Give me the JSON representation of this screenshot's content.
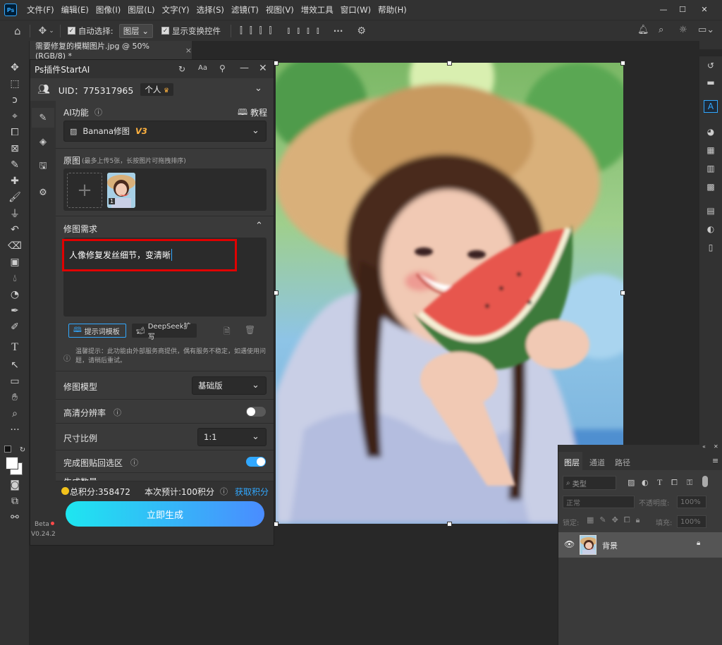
{
  "app": {
    "logo": "Ps"
  },
  "menu": [
    "文件(F)",
    "编辑(E)",
    "图像(I)",
    "图层(L)",
    "文字(Y)",
    "选择(S)",
    "滤镜(T)",
    "视图(V)",
    "增效工具",
    "窗口(W)",
    "帮助(H)"
  ],
  "options": {
    "auto_select_label": "自动选择:",
    "auto_select_value": "图层",
    "show_transform_label": "显示变换控件",
    "more": "···"
  },
  "document": {
    "tab_title": "需要修复的模糊图片.jpg @ 50%(RGB/8) *",
    "close": "×"
  },
  "plugin": {
    "title": "Ps插件StartAI",
    "uid": "UID：775317965",
    "plan": "个人",
    "ai_feature_label": "AI功能",
    "tutorial": "教程",
    "feature_select": "Banana修图",
    "feature_version": "V3",
    "source_label": "原图",
    "source_hint": "(最多上传5张，长按图片可拖拽排序)",
    "thumb_index": "1",
    "request_label": "修图需求",
    "request_text": "人像修复发丝细节，变清晰",
    "prompt_template": "提示词模板",
    "deepseek": "DeepSeek扩写",
    "notice": "温馨提示：此功能由外部服务商提供，偶有服务不稳定，如遇使用问题，请稍后重试。",
    "model_label": "修图模型",
    "model_value": "基础版",
    "hd_label": "高清分辨率",
    "hd_on": false,
    "ratio_label": "尺寸比例",
    "ratio_value": "1:1",
    "paste_back_label": "完成图贴回选区",
    "paste_back_on": true,
    "partial_label": "生成数量",
    "points_total": "总积分:358472",
    "points_cost": "本次预计:100积分",
    "get_points": "获取积分",
    "generate": "立即生成",
    "beta": "Beta",
    "version": "V0.24.2",
    "accent": "#31a8ff",
    "generate_gradient": [
      "#1ee6f0",
      "#4a8cff"
    ],
    "highlight_color": "#e00000"
  },
  "layers_panel": {
    "tabs": [
      "图层",
      "通道",
      "路径"
    ],
    "filter_kind": "类型",
    "blend_mode": "正常",
    "opacity_label": "不透明度:",
    "opacity_value": "100%",
    "lock_label": "锁定:",
    "fill_label": "填充:",
    "fill_value": "100%",
    "layer_name": "背景"
  }
}
